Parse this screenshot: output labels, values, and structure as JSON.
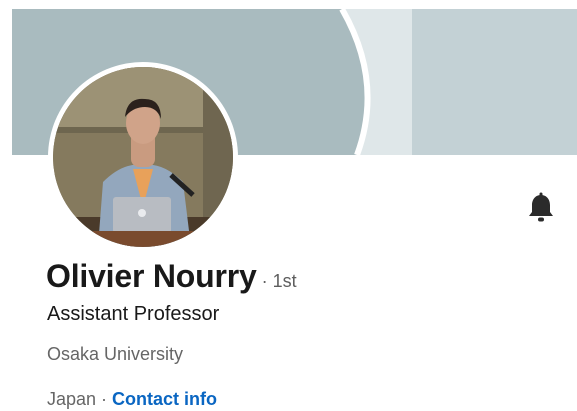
{
  "profile": {
    "name": "Olivier Nourry",
    "connection_degree": "· 1st",
    "headline": "Assistant Professor",
    "organization": "Osaka University",
    "location": "Japan",
    "separator": " · ",
    "contact_info_label": "Contact info"
  },
  "icons": {
    "notification": "bell-icon",
    "avatar": "profile-photo"
  },
  "colors": {
    "banner": "#c3d1d5",
    "link": "#0a66c2",
    "text_primary": "#191919",
    "text_secondary": "#666666"
  }
}
